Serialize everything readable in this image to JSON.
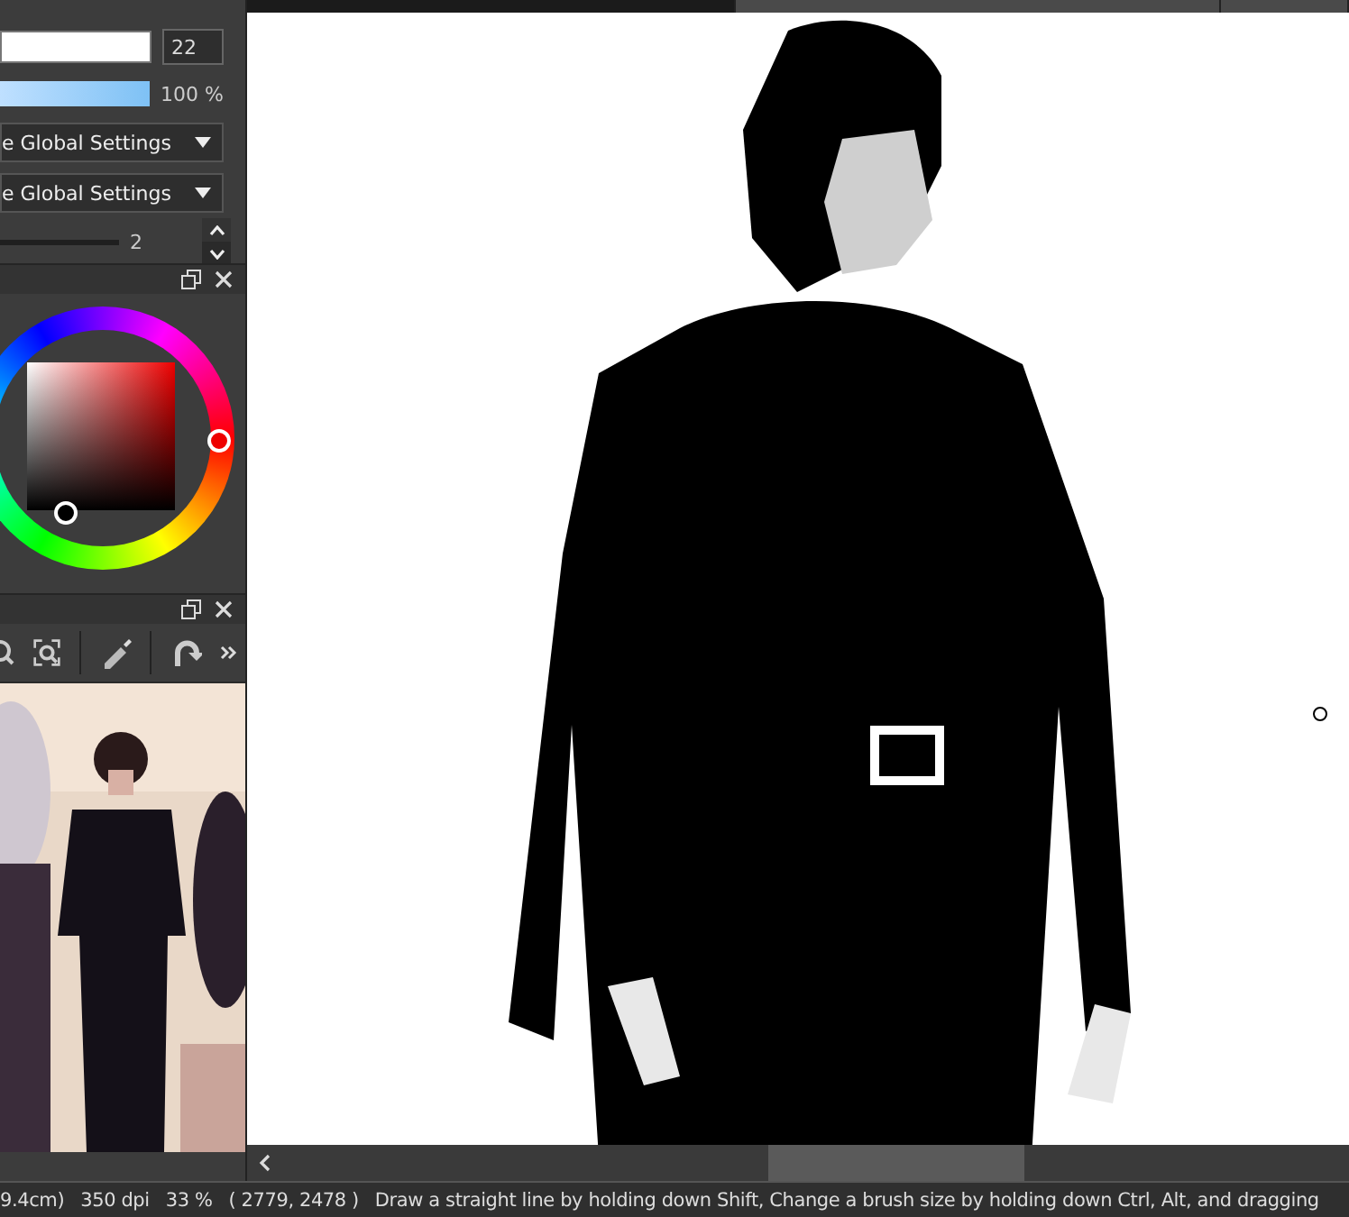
{
  "tabs": [
    {
      "selected": true
    },
    {
      "selected": false
    },
    {
      "selected": false
    }
  ],
  "tool_property": {
    "brush_size": {
      "level": 1,
      "value": "22"
    },
    "opacity": {
      "level": 1,
      "reading": "100 %"
    },
    "dropdowns": [
      {
        "value": "e Global Settings"
      },
      {
        "value": "e Global Settings"
      }
    ],
    "stabilization": {
      "level": 1,
      "value": "2"
    }
  },
  "status_bar": {
    "items": [
      "9.4cm)",
      "350 dpi",
      "33 %",
      "( 2779, 2478 )",
      "Draw a straight line by holding down Shift, Change a brush size by holding down Ctrl, Alt, and dragging"
    ]
  }
}
